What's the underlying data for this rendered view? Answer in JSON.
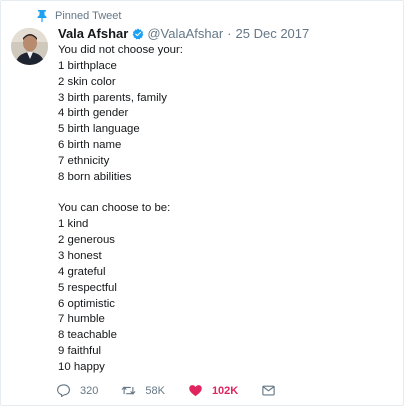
{
  "pinned_label": "Pinned Tweet",
  "author": {
    "name": "Vala Afshar",
    "handle": "@ValaAfshar",
    "separator": "·",
    "date": "25 Dec 2017"
  },
  "tweet_lines": {
    "intro": "You did not choose your:",
    "not_chosen": [
      "1 birthplace",
      "2 skin color",
      "3 birth parents, family",
      "4 birth gender",
      "5 birth language",
      "6 birth name",
      "7 ethnicity",
      "8 born abilities"
    ],
    "choose_intro": "You can choose to be:",
    "chosen": [
      "1 kind",
      "2 generous",
      "3 honest",
      "4 grateful",
      "5 respectful",
      "6 optimistic",
      "7 humble",
      "8 teachable",
      "9 faithful",
      "10 happy"
    ]
  },
  "actions": {
    "replies": "320",
    "retweets": "58K",
    "likes": "102K"
  },
  "colors": {
    "accent": "#1da1f2",
    "like": "#e0245e",
    "muted": "#657786"
  },
  "icons": {
    "pin": "pin-icon",
    "verified": "verified-badge-icon",
    "reply": "reply-icon",
    "retweet": "retweet-icon",
    "like": "heart-icon",
    "dm": "envelope-icon"
  }
}
